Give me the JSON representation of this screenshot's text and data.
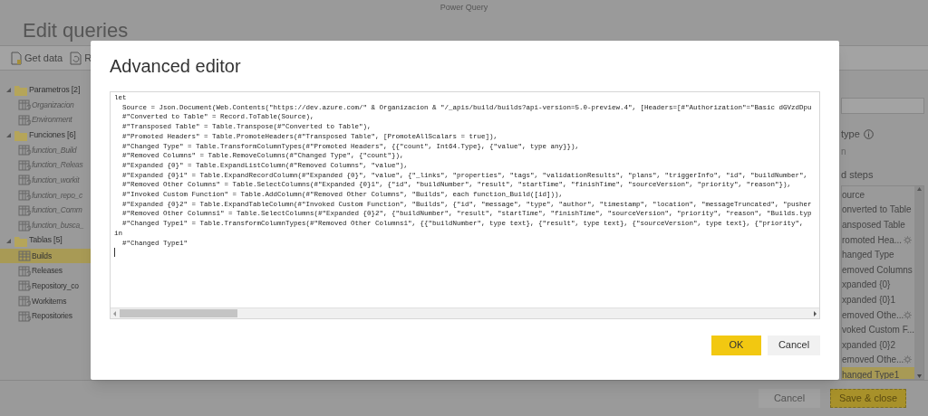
{
  "window": {
    "title": "Power Query"
  },
  "header": {
    "title": "Edit queries"
  },
  "toolbar": [
    {
      "label": "Get data",
      "kind": "data"
    },
    {
      "label": "R",
      "kind": "refresh"
    }
  ],
  "sidebar": {
    "groups": [
      {
        "label": "Parametros [2]",
        "expanded": true,
        "children": [
          {
            "label": "Organizacion",
            "kind": "parameter",
            "selected": false
          },
          {
            "label": "Environment",
            "kind": "parameter",
            "selected": false
          }
        ]
      },
      {
        "label": "Funciones [6]",
        "expanded": true,
        "children": [
          {
            "label": "function_Build",
            "kind": "function",
            "selected": false
          },
          {
            "label": "function_Releas",
            "kind": "function",
            "selected": false
          },
          {
            "label": "function_workit",
            "kind": "function",
            "selected": false
          },
          {
            "label": "function_repo_c",
            "kind": "function",
            "selected": false
          },
          {
            "label": "function_Comm",
            "kind": "function",
            "selected": false
          },
          {
            "label": "function_busca_",
            "kind": "function",
            "selected": false
          }
        ]
      },
      {
        "label": "Tablas [5]",
        "expanded": true,
        "children": [
          {
            "label": "Builds",
            "kind": "table",
            "selected": true
          },
          {
            "label": "Releases",
            "kind": "table",
            "selected": false
          },
          {
            "label": "Repository_co",
            "kind": "table",
            "selected": false
          },
          {
            "label": "Workitems",
            "kind": "table",
            "selected": false
          },
          {
            "label": "Repositories",
            "kind": "table",
            "selected": false
          }
        ]
      }
    ]
  },
  "properties": {
    "type_label": "type",
    "type_value": "n",
    "steps_label": "d steps",
    "steps": [
      {
        "label": "ource",
        "settings": false,
        "selected": false
      },
      {
        "label": "onverted to Table",
        "settings": false,
        "selected": false
      },
      {
        "label": "ansposed Table",
        "settings": false,
        "selected": false
      },
      {
        "label": "romoted Hea...",
        "settings": true,
        "selected": false
      },
      {
        "label": "hanged Type",
        "settings": false,
        "selected": false
      },
      {
        "label": "emoved Columns",
        "settings": false,
        "selected": false
      },
      {
        "label": "xpanded {0}",
        "settings": false,
        "selected": false
      },
      {
        "label": "xpanded {0}1",
        "settings": false,
        "selected": false
      },
      {
        "label": "emoved Othe...",
        "settings": true,
        "selected": false
      },
      {
        "label": "voked Custom F...",
        "settings": false,
        "selected": false
      },
      {
        "label": "xpanded {0}2",
        "settings": false,
        "selected": false
      },
      {
        "label": "emoved Othe...",
        "settings": true,
        "selected": false
      },
      {
        "label": "hanged Type1",
        "settings": false,
        "selected": true
      }
    ]
  },
  "footer": {
    "buttons": [
      {
        "label": "Cancel",
        "kind": "secondary"
      },
      {
        "label": "Save & close",
        "kind": "primary"
      }
    ]
  },
  "dialog": {
    "title": "Advanced editor",
    "code_lines": [
      "let",
      "  Source = Json.Document(Web.Contents(\"https://dev.azure.com/\" & Organizacion & \"/_apis/build/builds?api-version=5.0-preview.4\", [Headers=[#\"Authorization\"=\"Basic dGVzdDpu",
      "  #\"Converted to Table\" = Record.ToTable(Source),",
      "  #\"Transposed Table\" = Table.Transpose(#\"Converted to Table\"),",
      "  #\"Promoted Headers\" = Table.PromoteHeaders(#\"Transposed Table\", [PromoteAllScalars = true]),",
      "  #\"Changed Type\" = Table.TransformColumnTypes(#\"Promoted Headers\", {{\"count\", Int64.Type}, {\"value\", type any}}),",
      "  #\"Removed Columns\" = Table.RemoveColumns(#\"Changed Type\", {\"count\"}),",
      "  #\"Expanded {0}\" = Table.ExpandListColumn(#\"Removed Columns\", \"value\"),",
      "  #\"Expanded {0}1\" = Table.ExpandRecordColumn(#\"Expanded {0}\", \"value\", {\"_links\", \"properties\", \"tags\", \"validationResults\", \"plans\", \"triggerInfo\", \"id\", \"buildNumber\",",
      "  #\"Removed Other Columns\" = Table.SelectColumns(#\"Expanded {0}1\", {\"id\", \"buildNumber\", \"result\", \"startTime\", \"finishTime\", \"sourceVersion\", \"priority\", \"reason\"}),",
      "  #\"Invoked Custom Function\" = Table.AddColumn(#\"Removed Other Columns\", \"Builds\", each function_Build([id])),",
      "  #\"Expanded {0}2\" = Table.ExpandTableColumn(#\"Invoked Custom Function\", \"Builds\", {\"id\", \"message\", \"type\", \"author\", \"timestamp\", \"location\", \"messageTruncated\", \"pusher",
      "  #\"Removed Other Columns1\" = Table.SelectColumns(#\"Expanded {0}2\", {\"buildNumber\", \"result\", \"startTime\", \"finishTime\", \"sourceVersion\", \"priority\", \"reason\", \"Builds.typ",
      "  #\"Changed Type1\" = Table.TransformColumnTypes(#\"Removed Other Columns1\", {{\"buildNumber\", type text}, {\"result\", type text}, {\"sourceVersion\", type text}, {\"priority\",",
      "in",
      "  #\"Changed Type1\""
    ],
    "buttons": [
      {
        "label": "OK",
        "kind": "primary"
      },
      {
        "label": "Cancel",
        "kind": "secondary"
      }
    ]
  }
}
